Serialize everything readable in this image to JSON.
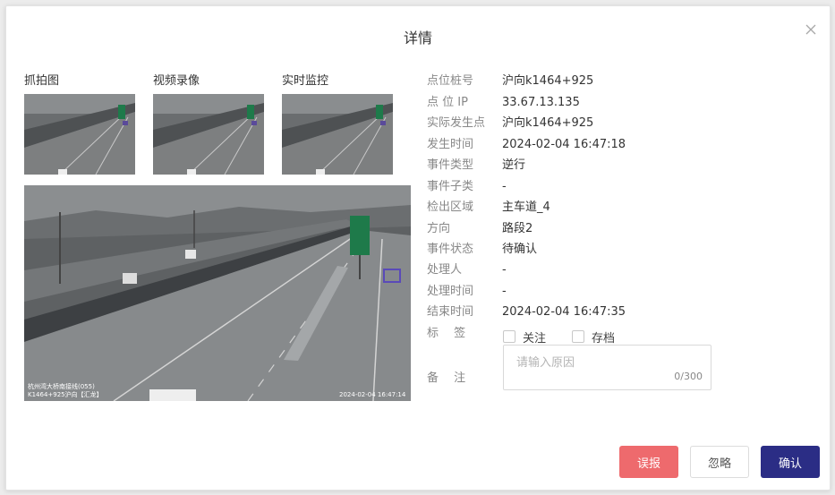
{
  "dialog": {
    "title": "详情"
  },
  "media": {
    "tabs": [
      {
        "label": "抓拍图"
      },
      {
        "label": "视频录像"
      },
      {
        "label": "实时监控"
      }
    ],
    "main_image": {
      "overlay_location_line1": "杭州湾大桥南接线(055)",
      "overlay_location_line2": "K1464+925沪向【汇龙】",
      "overlay_timestamp": "2024-02-04 16:47:14"
    }
  },
  "details": [
    {
      "label": "点位桩号",
      "value": "沪向k1464+925"
    },
    {
      "label": "点 位 IP",
      "value": "33.67.13.135"
    },
    {
      "label": "实际发生点",
      "value": "沪向k1464+925"
    },
    {
      "label": "发生时间",
      "value": "2024-02-04 16:47:18"
    },
    {
      "label": "事件类型",
      "value": "逆行"
    },
    {
      "label": "事件子类",
      "value": "-"
    },
    {
      "label": "检出区域",
      "value": "主车道_4"
    },
    {
      "label": "方向",
      "value": "路段2"
    },
    {
      "label": "事件状态",
      "value": "待确认"
    },
    {
      "label": "处理人",
      "value": "-"
    },
    {
      "label": "处理时间",
      "value": "-"
    },
    {
      "label": "结束时间",
      "value": "2024-02-04 16:47:35"
    }
  ],
  "tags": {
    "label": "标　 签",
    "options": [
      {
        "label": "关注",
        "checked": false
      },
      {
        "label": "存档",
        "checked": false
      }
    ]
  },
  "remark": {
    "label": "备　 注",
    "placeholder": "请输入原因",
    "count": "0/300"
  },
  "buttons": {
    "misreport": "误报",
    "ignore": "忽略",
    "confirm": "确认"
  },
  "colors": {
    "misreport_bg": "#ee6a6d",
    "confirm_bg": "#2b2d85",
    "sign_green": "#1e7a4a"
  }
}
